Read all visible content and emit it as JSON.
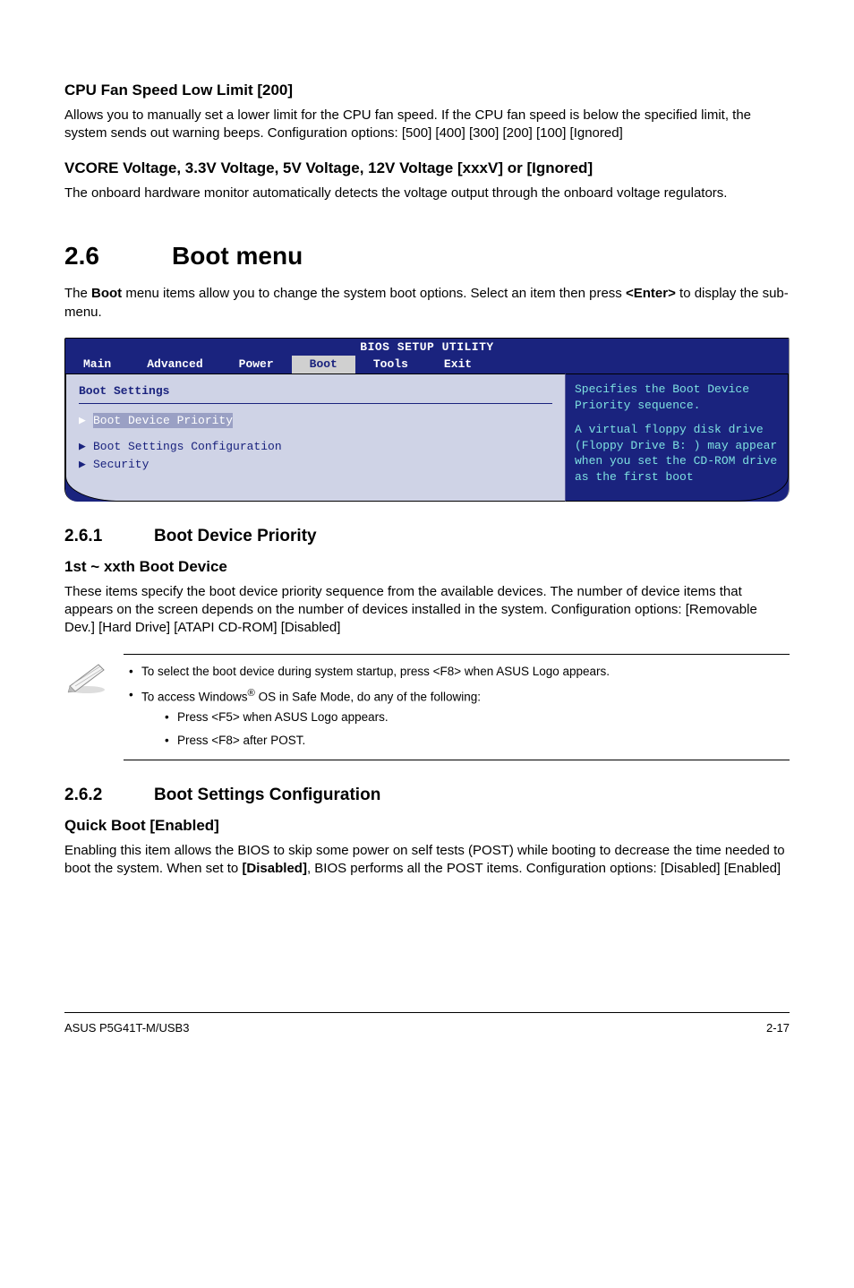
{
  "s1": {
    "heading": "CPU Fan Speed Low Limit [200]",
    "body": "Allows you to manually set a lower limit for the CPU fan speed. If the CPU fan speed is below the specified limit, the system sends out warning beeps. Configuration options: [500] [400] [300] [200] [100] [Ignored]"
  },
  "s2": {
    "heading": "VCORE Voltage, 3.3V Voltage, 5V Voltage, 12V Voltage [xxxV] or [Ignored]",
    "body": "The onboard hardware monitor automatically detects the voltage output through the onboard voltage regulators."
  },
  "chapter": {
    "num": "2.6",
    "title": "Boot menu",
    "intro_pre": "The ",
    "intro_bold1": "Boot",
    "intro_mid": " menu items allow you to change the system boot options. Select an item then press ",
    "intro_bold2": "<Enter>",
    "intro_post": " to display the sub-menu."
  },
  "bios": {
    "title": "BIOS SETUP UTILITY",
    "tabs": [
      "Main",
      "Advanced",
      "Power",
      "Boot",
      "Tools",
      "Exit"
    ],
    "active_tab_index": 3,
    "left_title": "Boot Settings",
    "rows": [
      {
        "label": "Boot Device Priority",
        "selected": true
      },
      {
        "label": "Boot Settings Configuration",
        "selected": false
      },
      {
        "label": "Security",
        "selected": false
      }
    ],
    "help1": "Specifies the Boot Device Priority sequence.",
    "help2": "A virtual floppy disk drive (Floppy Drive B: ) may appear when you set the CD-ROM drive as the first boot"
  },
  "sub1": {
    "num": "2.6.1",
    "title": "Boot Device Priority",
    "minor": "1st ~ xxth Boot Device",
    "body": "These items specify the boot device priority sequence from the available devices. The number of device items that appears on the screen depends on the number of devices installed in the system. Configuration options: [Removable Dev.] [Hard Drive] [ATAPI CD-ROM] [Disabled]"
  },
  "note": {
    "li1": "To select the boot device during system startup, press <F8> when ASUS Logo appears.",
    "li2_pre": "To access Windows",
    "li2_sup": "®",
    "li2_post": " OS in Safe Mode, do any of the following:",
    "li2a": "Press <F5> when ASUS Logo appears.",
    "li2b": "Press <F8> after POST."
  },
  "sub2": {
    "num": "2.6.2",
    "title": "Boot Settings Configuration",
    "minor": "Quick Boot [Enabled]",
    "body_pre": "Enabling this item allows the BIOS to skip some power on self tests (POST) while booting to decrease the time needed to boot the system. When set to ",
    "body_bold": "[Disabled]",
    "body_post": ", BIOS performs all the POST items. Configuration options: [Disabled] [Enabled]"
  },
  "footer": {
    "left": "ASUS P5G41T-M/USB3",
    "right": "2-17"
  }
}
